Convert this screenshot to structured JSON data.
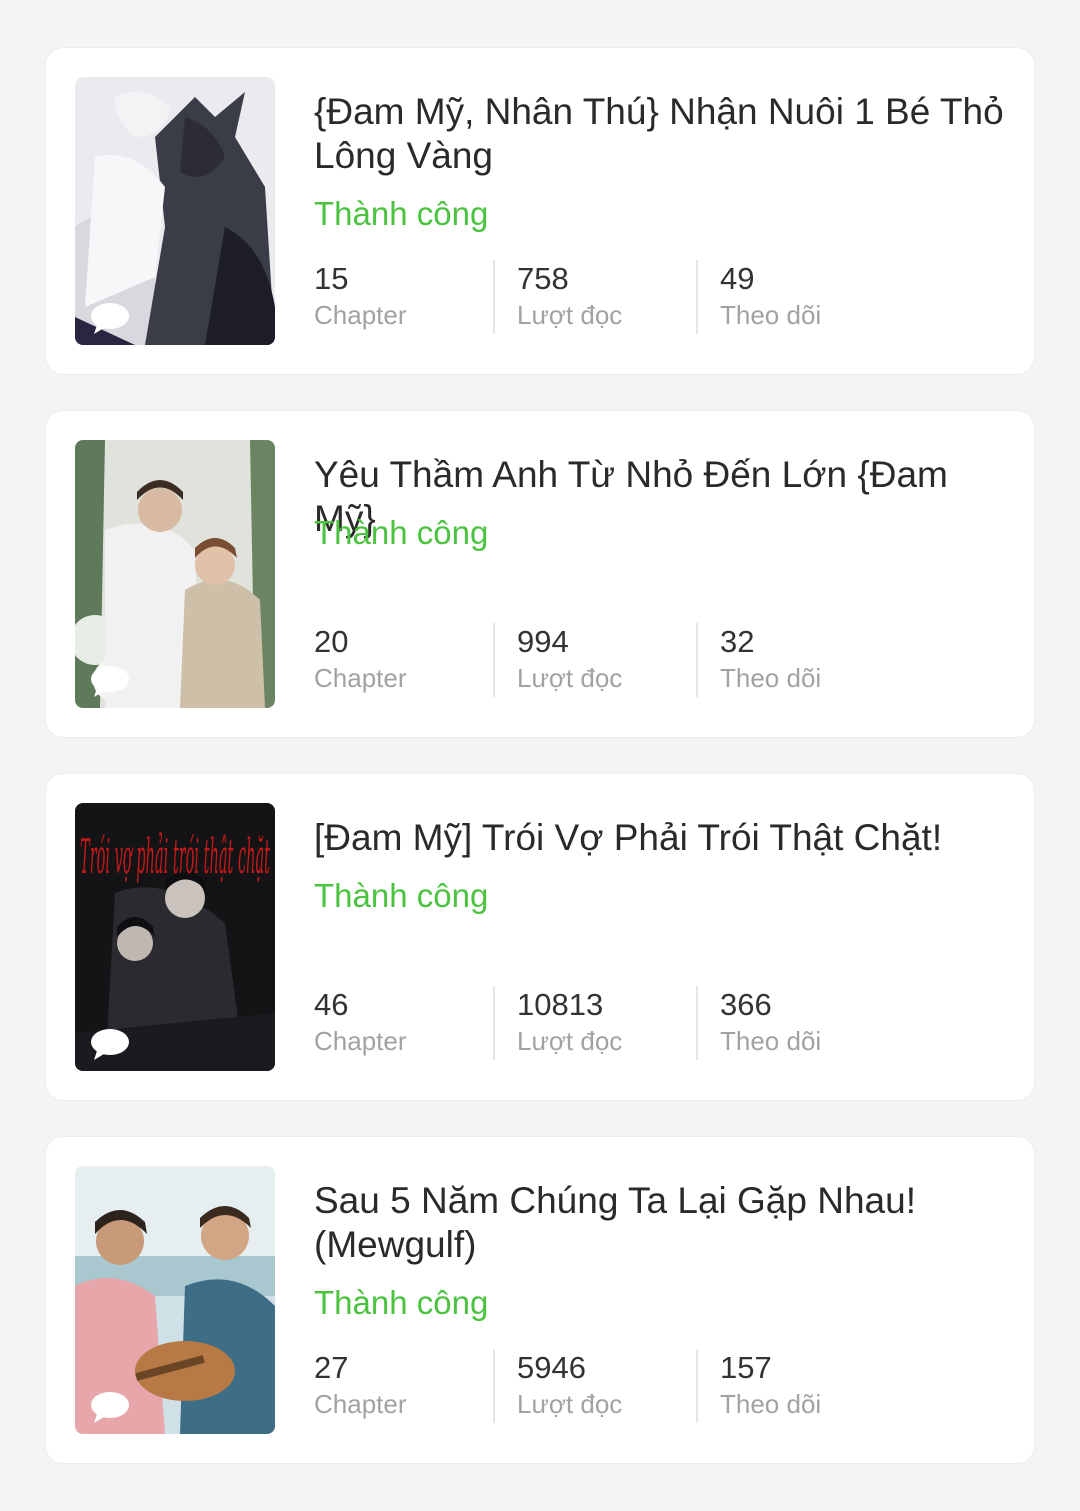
{
  "colors": {
    "status": "#4cc340",
    "background": "#f4f4f4"
  },
  "stories": [
    {
      "title": "{Đam Mỹ, Nhân Thú} Nhận Nuôi 1 Bé Thỏ Lông Vàng",
      "status": "Thành công",
      "chapters": "15",
      "chapters_label": "Chapter",
      "reads": "758",
      "reads_label": "Lượt đọc",
      "follows": "49",
      "follows_label": "Theo dõi",
      "cover_icon": "comment-bubble-icon"
    },
    {
      "title": "Yêu Thầm Anh Từ Nhỏ Đến Lớn {Đam Mỹ}",
      "status": "Thành công",
      "chapters": "20",
      "chapters_label": "Chapter",
      "reads": "994",
      "reads_label": "Lượt đọc",
      "follows": "32",
      "follows_label": "Theo dõi",
      "cover_icon": "comment-bubble-icon"
    },
    {
      "title": "[Đam Mỹ] Trói Vợ Phải Trói Thật Chặt!",
      "status": "Thành công",
      "chapters": "46",
      "chapters_label": "Chapter",
      "reads": "10813",
      "reads_label": "Lượt đọc",
      "follows": "366",
      "follows_label": "Theo dõi",
      "cover_text": "Trói vợ phải trói thật chặt",
      "cover_icon": "comment-bubble-icon"
    },
    {
      "title": "Sau 5 Năm Chúng Ta Lại Gặp Nhau! (Mewgulf)",
      "status": "Thành công",
      "chapters": "27",
      "chapters_label": "Chapter",
      "reads": "5946",
      "reads_label": "Lượt đọc",
      "follows": "157",
      "follows_label": "Theo dõi",
      "cover_icon": "comment-bubble-icon"
    }
  ]
}
